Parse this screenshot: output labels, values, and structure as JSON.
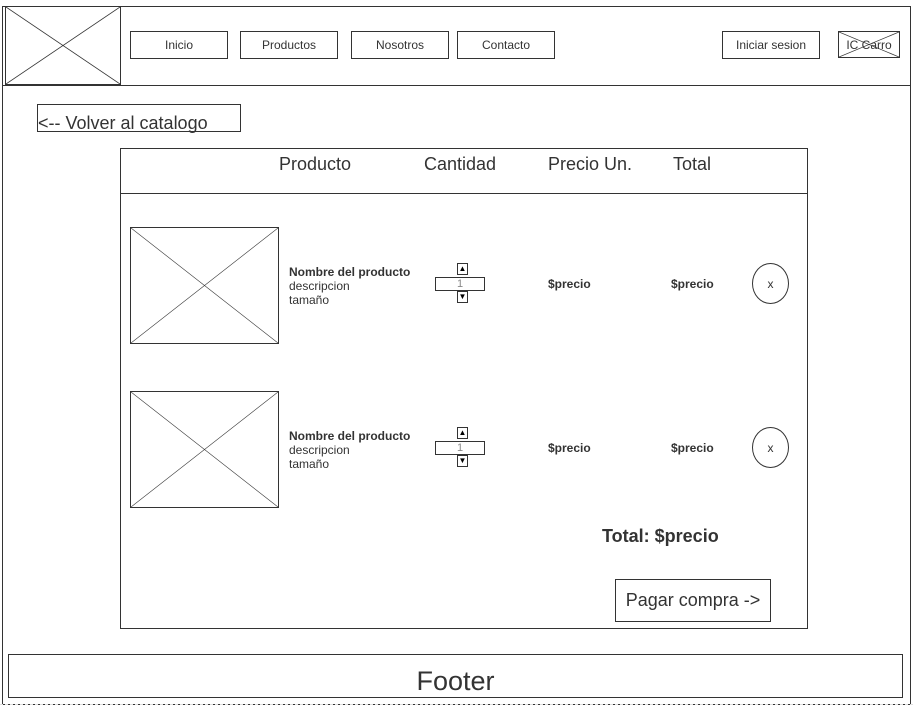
{
  "header": {
    "logo_icon": "image-placeholder-icon",
    "nav": [
      "Inicio",
      "Productos",
      "Nosotros",
      "Contacto"
    ],
    "login_label": "Iniciar sesion",
    "cart_label": "IC Carro"
  },
  "back_link": "<-- Volver al catalogo",
  "cart": {
    "columns": {
      "product": "Producto",
      "quantity": "Cantidad",
      "unit_price": "Precio Un.",
      "total": "Total"
    },
    "items": [
      {
        "image_icon": "image-placeholder-icon",
        "name": "Nombre del producto",
        "description": "descripcion",
        "size": "tamaño",
        "quantity": "1",
        "unit_price": "$precio",
        "total": "$precio",
        "remove_label": "x"
      },
      {
        "image_icon": "image-placeholder-icon",
        "name": "Nombre del producto",
        "description": "descripcion",
        "size": "tamaño",
        "quantity": "1",
        "unit_price": "$precio",
        "total": "$precio",
        "remove_label": "x"
      }
    ],
    "total_label": "Total: $precio",
    "checkout_label": "Pagar compra ->"
  },
  "footer": {
    "label": "Footer"
  },
  "icons": {
    "up": "▲",
    "down": "▼"
  },
  "colors": {
    "stroke": "#333333",
    "background": "#ffffff"
  }
}
